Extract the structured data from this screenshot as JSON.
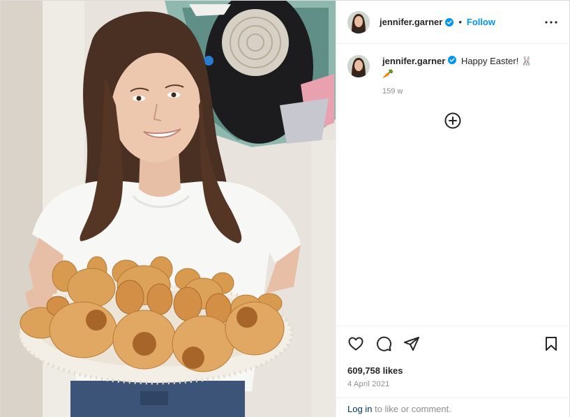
{
  "post": {
    "username": "jennifer.garner",
    "follow_label": "Follow",
    "header_separator": "•",
    "caption_text": "Happy Easter! 🐰",
    "caption_text_2": "🥕",
    "caption_age": "159 w",
    "likes": "609,758 likes",
    "date": "4 April 2021",
    "login_link": "Log in",
    "login_suffix": " to like or comment."
  },
  "icons": {
    "verified": "verified-badge-icon",
    "more": "more-options-icon",
    "load_more": "plus-circle-icon",
    "like": "heart-icon",
    "comment": "comment-icon",
    "share": "share-icon",
    "save": "bookmark-icon"
  },
  "colors": {
    "link_blue": "#0095f6",
    "verified_blue": "#0095f6",
    "login_link": "#00376b",
    "muted_text": "#8e8e8e",
    "divider": "#efefef"
  }
}
